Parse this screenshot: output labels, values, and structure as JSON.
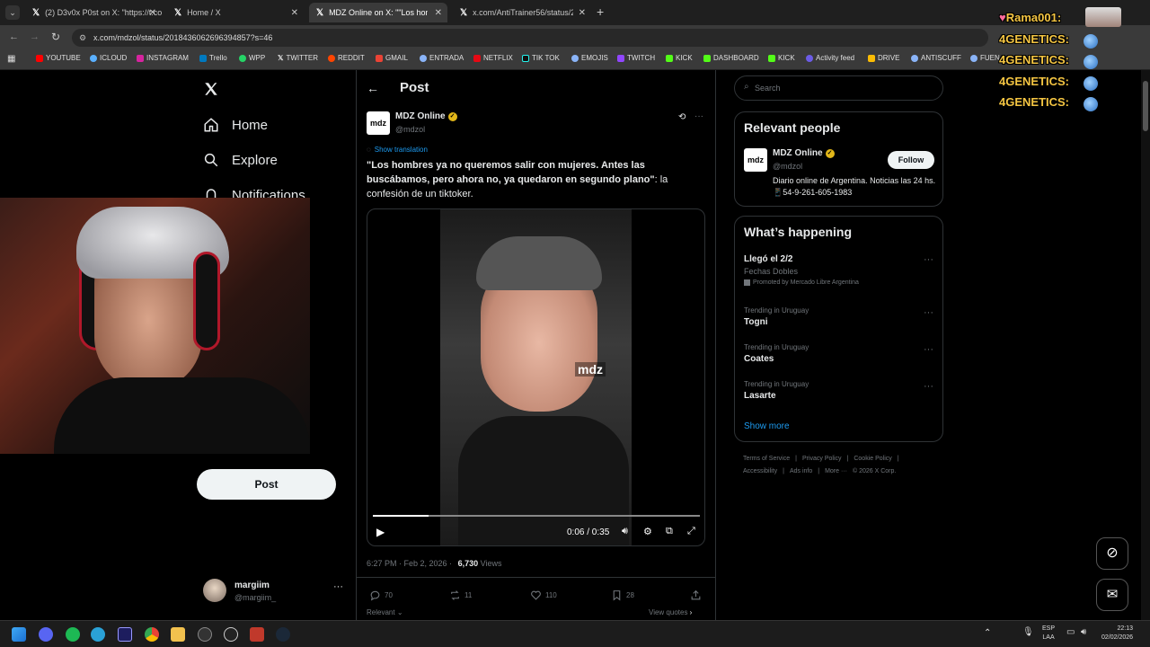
{
  "browser": {
    "tabs": [
      {
        "label": "(2) D3v0x P0st on X: \"https://t.co",
        "active": false
      },
      {
        "label": "Home / X",
        "active": false
      },
      {
        "label": "MDZ Online on X: \"\"Los hombres",
        "active": true
      },
      {
        "label": "x.com/AntiTrainer56/status/20",
        "active": false
      }
    ],
    "url": "x.com/mdzol/status/2018436062696394857?s=46",
    "bookmarks": [
      "YOUTUBE",
      "ICLOUD",
      "INSTAGRAM",
      "Trello",
      "WPP",
      "TWITTER",
      "REDDIT",
      "GMAIL",
      "ENTRADA",
      "NETFLIX",
      "TIK TOK",
      "EMOJIS",
      "TWITCH",
      "KICK",
      "DASHBOARD",
      "KICK",
      "Activity feed",
      "DRIVE",
      "ANTISCUFF",
      "FUEN"
    ]
  },
  "sidebar": {
    "home": "Home",
    "explore": "Explore",
    "notifications": "Notifications",
    "post_button": "Post",
    "account_name": "margiim",
    "account_handle": "@margiim_"
  },
  "post": {
    "header_title": "Post",
    "author_name": "MDZ Online",
    "author_handle": "@mdzol",
    "avatar_text": "mdz",
    "show_translation": "Show translation",
    "text_bold": "\"Los hombres ya no queremos salir con mujeres. Antes las buscábamos, pero ahora no, ya quedaron en segundo plano\"",
    "text_rest": ": la confesión de un tiktoker.",
    "video_watermark": "mdz",
    "video_time": "0:06 / 0:35",
    "video_progress": 0.17,
    "timestamp": "6:27 PM · Feb 2, 2026 ·",
    "views_count": "6,730",
    "views_label": "Views",
    "replies": "70",
    "reposts": "11",
    "likes": "110",
    "bookmarks": "28",
    "relevant": "Relevant",
    "view_quotes": "View quotes"
  },
  "right": {
    "search_placeholder": "Search",
    "relevant_title": "Relevant people",
    "person_name": "MDZ Online",
    "person_handle": "@mdzol",
    "person_bio": "Diario online de Argentina. Noticias las 24 hs. 📱54-9-261-605-1983",
    "follow": "Follow",
    "happening_title": "What’s happening",
    "trends": [
      {
        "category": "",
        "name": "Llegó el 2/2",
        "sub": "Fechas Dobles",
        "promo": "Promoted by Mercado Libre Argentina"
      },
      {
        "category": "Trending in Uruguay",
        "name": "Togni"
      },
      {
        "category": "Trending in Uruguay",
        "name": "Coates"
      },
      {
        "category": "Trending in Uruguay",
        "name": "Lasarte"
      }
    ],
    "show_more": "Show more",
    "footer_row1": [
      "Terms of Service",
      "|",
      "Privacy Policy",
      "|",
      "Cookie Policy",
      "|"
    ],
    "footer_row2": [
      "Accessibility",
      "|",
      "Ads info",
      "|",
      "More ···",
      "© 2026 X Corp."
    ]
  },
  "chat": [
    {
      "user": "Rama001:"
    },
    {
      "user": "4GENETICS:"
    },
    {
      "user": "4GENETICS:"
    },
    {
      "user": "4GENETICS:"
    },
    {
      "user": "4GENETICS:"
    }
  ],
  "taskbar": {
    "lang": "ESP",
    "lang2": "LAA",
    "time": "22:13",
    "date": "02/02/2026"
  },
  "colors": {
    "x_blue": "#1d9bf0",
    "verified_gold": "#e2b719",
    "chat_gold": "#f4c542"
  }
}
